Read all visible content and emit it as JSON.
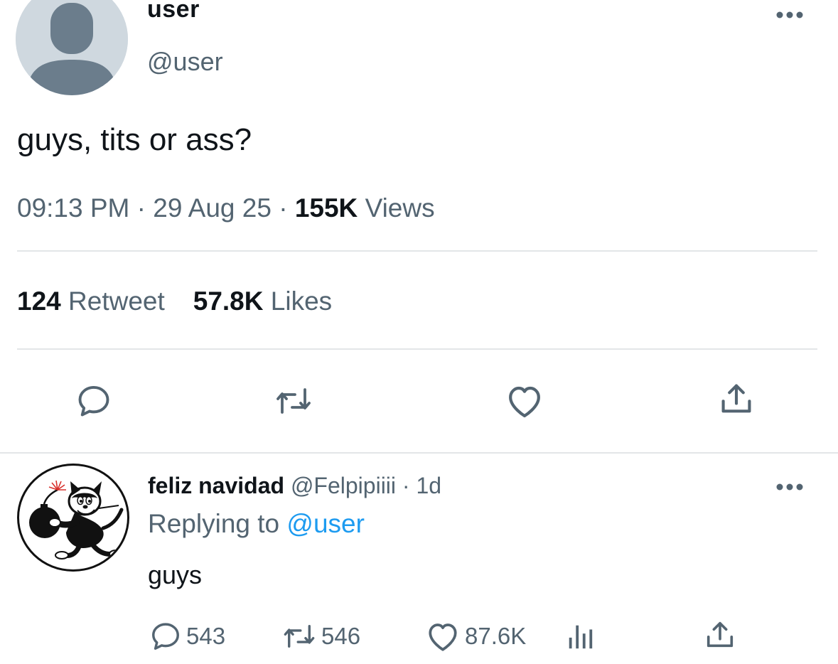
{
  "tweet": {
    "display_name": "user",
    "handle": "@user",
    "text": "guys, tits or ass?",
    "time": "09:13 PM",
    "date": "29 Aug 25",
    "views_count": "155K",
    "views_label": "Views",
    "retweets_count": "124",
    "retweets_label": "Retweet",
    "likes_count": "57.8K",
    "likes_label": "Likes"
  },
  "reply": {
    "display_name": "feliz navidad",
    "handle": "@Felpipiiii",
    "age": "1d",
    "replying_label": "Replying to",
    "replying_to": "@user",
    "text": "guys",
    "comments": "543",
    "retweets": "546",
    "likes": "87.6K"
  },
  "icons": {
    "more": "more-dots-icon",
    "reply": "comment-bubble-icon",
    "retweet": "retweet-icon",
    "like": "heart-icon",
    "share": "share-icon",
    "views": "bar-chart-icon"
  },
  "colors": {
    "text": "#0f1419",
    "secondary": "#536471",
    "link": "#1d9bf0",
    "divider": "#e3e6e8",
    "avatar_placeholder": "#cfd8df"
  }
}
